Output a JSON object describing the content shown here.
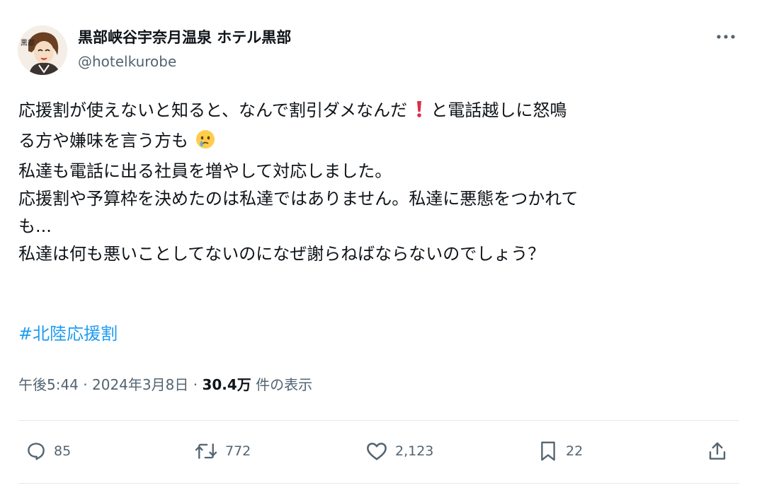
{
  "author": {
    "display_name": "黒部峡谷宇奈月温泉 ホテル黒部",
    "handle": "@hotelkurobe",
    "avatar_text": "黒部"
  },
  "body": {
    "line1a": "応援割が使えないと知ると、なんで割引ダメなんだ",
    "line1b": "と電話越しに怒鳴",
    "line2": "る方や嫌味を言う方も",
    "line3": "私達も電話に出る社員を増やして対応しました。",
    "line4": "応援割や予算枠を決めたのは私達ではありません。私達に悪態をつかれて",
    "line5": "も...",
    "line6": "私達は何も悪いことしてないのになぜ謝らねばならないのでしょう？",
    "emoji1": "exclamation-icon",
    "emoji2": "face-holding-back-tears-icon"
  },
  "hashtag": "#北陸応援割",
  "meta": {
    "time": "午後5:44",
    "separator": "·",
    "date": "2024年3月8日",
    "views_count": "30.4万",
    "views_label": "件の表示"
  },
  "actions": {
    "replies": "85",
    "reposts": "772",
    "likes": "2,123",
    "bookmarks": "22"
  },
  "colors": {
    "text": "#0f1419",
    "secondary": "#536471",
    "link": "#1d9bf0",
    "divider": "#e5e9ec"
  }
}
